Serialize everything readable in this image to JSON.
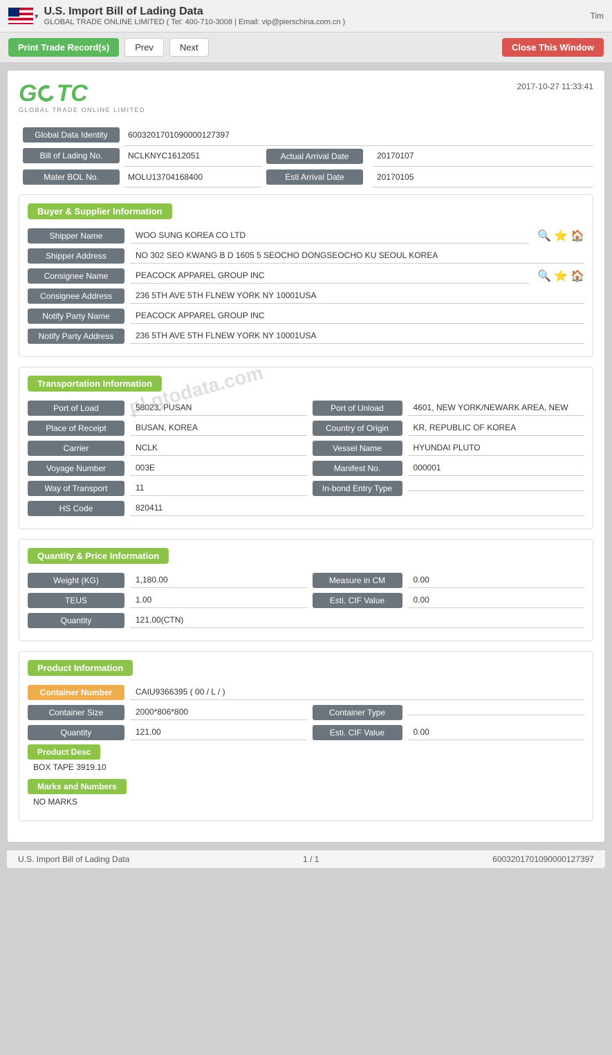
{
  "header": {
    "title": "U.S. Import Bill of Lading Data",
    "subtitle": "GLOBAL TRADE ONLINE LIMITED ( Tel: 400-710-3008 | Email: vip@pierschina.com.cn )",
    "user": "Tim"
  },
  "toolbar": {
    "print_label": "Print Trade Record(s)",
    "prev_label": "Prev",
    "next_label": "Next",
    "close_label": "Close This Window"
  },
  "document": {
    "timestamp": "2017-10-27 11:33:41",
    "logo_company": "GLOBAL TRADE ONLINE LIMITED",
    "global_data_identity_label": "Global Data Identity",
    "global_data_identity_value": "6003201701090000127397",
    "bill_of_lading_label": "Bill of Lading No.",
    "bill_of_lading_value": "NCLKNYC1612051",
    "actual_arrival_date_label": "Actual Arrival Date",
    "actual_arrival_date_value": "20170107",
    "mater_bol_label": "Mater BOL No.",
    "mater_bol_value": "MOLU13704168400",
    "esti_arrival_date_label": "Esti Arrival Date",
    "esti_arrival_date_value": "20170105"
  },
  "buyer_supplier": {
    "section_title": "Buyer & Supplier Information",
    "shipper_name_label": "Shipper Name",
    "shipper_name_value": "WOO SUNG KOREA CO LTD",
    "shipper_address_label": "Shipper Address",
    "shipper_address_value": "NO 302 SEO KWANG B D 1605 5 SEOCHO DONGSEOCHO KU SEOUL KOREA",
    "consignee_name_label": "Consignee Name",
    "consignee_name_value": "PEACOCK APPAREL GROUP INC",
    "consignee_address_label": "Consignee Address",
    "consignee_address_value": "236 5TH AVE 5TH FLNEW YORK NY 10001USA",
    "notify_party_name_label": "Notify Party Name",
    "notify_party_name_value": "PEACOCK APPAREL GROUP INC",
    "notify_party_address_label": "Notify Party Address",
    "notify_party_address_value": "236 5TH AVE 5TH FLNEW YORK NY 10001USA"
  },
  "transportation": {
    "section_title": "Transportation Information",
    "port_of_load_label": "Port of Load",
    "port_of_load_value": "58023, PUSAN",
    "port_of_unload_label": "Port of Unload",
    "port_of_unload_value": "4601, NEW YORK/NEWARK AREA, NEW",
    "place_of_receipt_label": "Place of Receipt",
    "place_of_receipt_value": "BUSAN, KOREA",
    "country_of_origin_label": "Country of Origin",
    "country_of_origin_value": "KR, REPUBLIC OF KOREA",
    "carrier_label": "Carrier",
    "carrier_value": "NCLK",
    "vessel_name_label": "Vessel Name",
    "vessel_name_value": "HYUNDAI PLUTO",
    "voyage_number_label": "Voyage Number",
    "voyage_number_value": "003E",
    "manifest_no_label": "Manifest No.",
    "manifest_no_value": "000001",
    "way_of_transport_label": "Way of Transport",
    "way_of_transport_value": "11",
    "in_bond_entry_type_label": "In-bond Entry Type",
    "in_bond_entry_type_value": "",
    "hs_code_label": "HS Code",
    "hs_code_value": "820411"
  },
  "quantity_price": {
    "section_title": "Quantity & Price Information",
    "weight_label": "Weight (KG)",
    "weight_value": "1,180.00",
    "measure_label": "Measure in CM",
    "measure_value": "0.00",
    "teus_label": "TEUS",
    "teus_value": "1.00",
    "esti_cif_label": "Esti. CIF Value",
    "esti_cif_value": "0.00",
    "quantity_label": "Quantity",
    "quantity_value": "121.00(CTN)"
  },
  "product": {
    "section_title": "Product Information",
    "container_number_label": "Container Number",
    "container_number_value": "CAIU9366395 ( 00 / L / )",
    "container_size_label": "Container Size",
    "container_size_value": "2000*806*800",
    "container_type_label": "Container Type",
    "container_type_value": "",
    "quantity_label": "Quantity",
    "quantity_value": "121.00",
    "esti_cif_label": "Esti. CIF Value",
    "esti_cif_value": "0.00",
    "product_desc_label": "Product Desc",
    "product_desc_value": "BOX TAPE 3919.10",
    "marks_and_numbers_label": "Marks and Numbers",
    "marks_and_numbers_value": "NO MARKS"
  },
  "footer": {
    "left_text": "U.S. Import Bill of Lading Data",
    "center_text": "1 / 1",
    "right_text": "6003201701090000127397"
  },
  "watermark": "pl.gtodata.com"
}
